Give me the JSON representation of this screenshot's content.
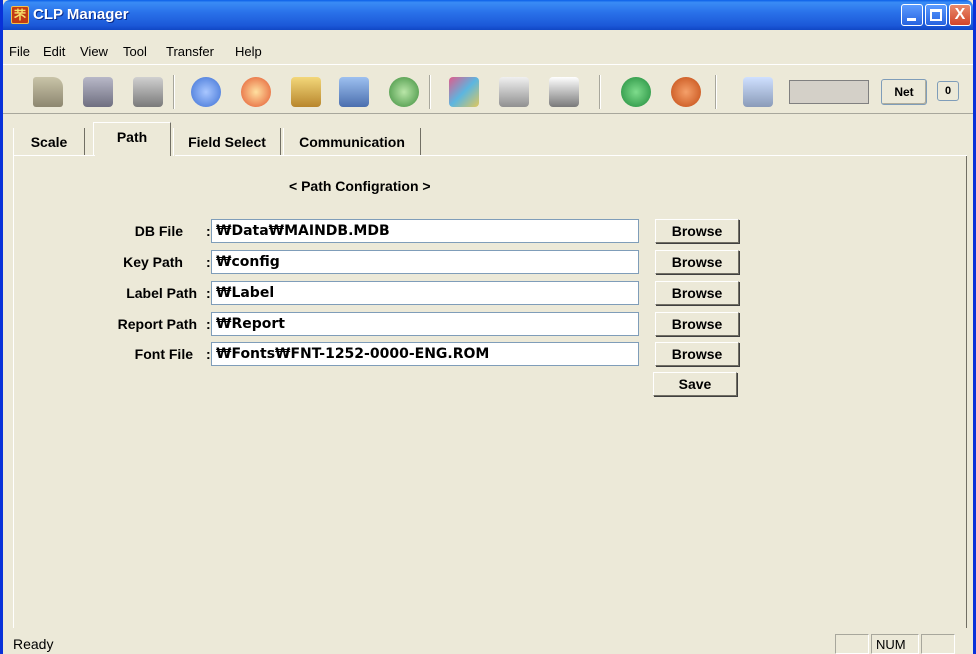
{
  "window": {
    "title": "CLP Manager",
    "title_icon": "app-logo-icon",
    "title_icon_glyph": "芣",
    "close_glyph": "X"
  },
  "menu": [
    {
      "label": "File",
      "underline": "F"
    },
    {
      "label": "Edit",
      "underline": "E"
    },
    {
      "label": "View",
      "underline": "V"
    },
    {
      "label": "Tool",
      "underline": "T"
    },
    {
      "label": "Transfer",
      "underline": "r"
    },
    {
      "label": "Help",
      "underline": "H"
    }
  ],
  "toolbar": {
    "icons": [
      "open-folder-icon",
      "save-disk-icon",
      "print-icon",
      "plu-icon",
      "star-icon",
      "upload-icon",
      "download-icon",
      "users-icon",
      "grid-icon",
      "label-icon",
      "keyboard-icon",
      "forward-icon",
      "back-icon",
      "settings-tools-icon"
    ],
    "net_label": "Net",
    "zero_label": "0"
  },
  "tabs": [
    {
      "label": "Scale",
      "active": false
    },
    {
      "label": "Path",
      "active": true
    },
    {
      "label": "Field Select",
      "active": false
    },
    {
      "label": "Communication",
      "active": false
    }
  ],
  "path_config": {
    "title": "< Path Configration >",
    "rows": [
      {
        "label": "DB File",
        "colon": ":",
        "value": "₩Data₩MAINDB.MDB",
        "button": "Browse"
      },
      {
        "label": "Key Path",
        "colon": ":",
        "value": "₩config",
        "button": "Browse"
      },
      {
        "label": "Label Path",
        "colon": ":",
        "value": "₩Label",
        "button": "Browse"
      },
      {
        "label": "Report Path",
        "colon": ":",
        "value": "₩Report",
        "button": "Browse"
      },
      {
        "label": "Font File",
        "colon": ":",
        "value": "₩Fonts₩FNT-1252-0000-ENG.ROM",
        "button": "Browse"
      }
    ],
    "save_label": "Save"
  },
  "status": {
    "text": "Ready",
    "num": "NUM"
  }
}
